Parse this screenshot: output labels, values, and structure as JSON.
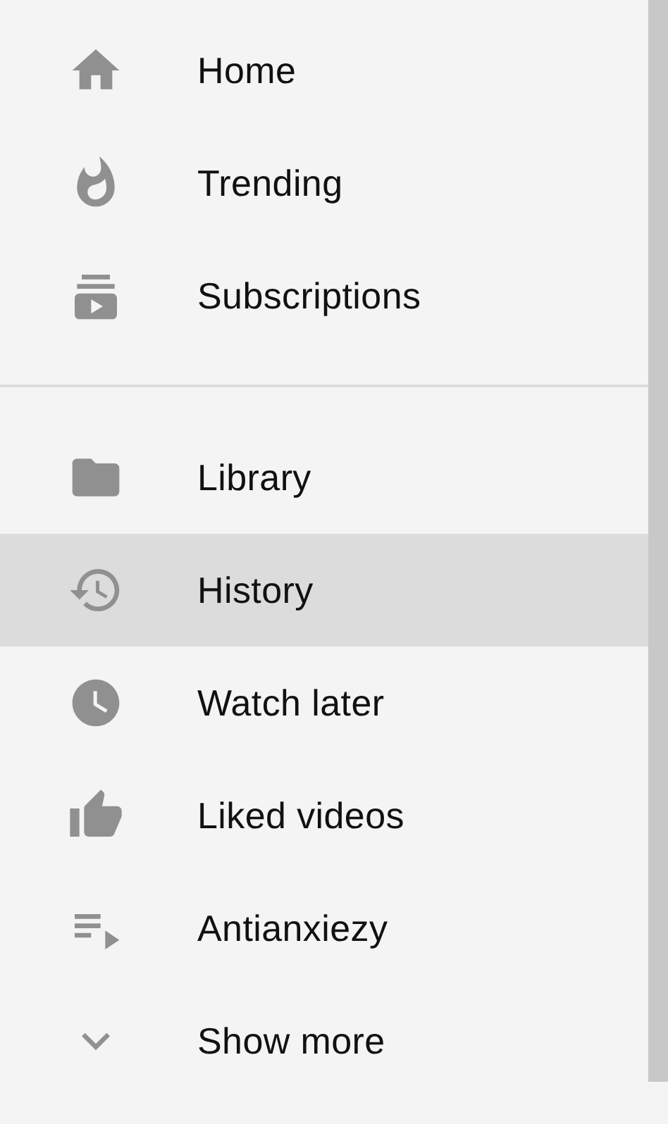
{
  "sections": [
    {
      "items": [
        {
          "label": "Home",
          "selected": false
        },
        {
          "label": "Trending",
          "selected": false
        },
        {
          "label": "Subscriptions",
          "selected": false
        }
      ]
    },
    {
      "items": [
        {
          "label": "Library",
          "selected": false
        },
        {
          "label": "History",
          "selected": true
        },
        {
          "label": "Watch later",
          "selected": false
        },
        {
          "label": "Liked videos",
          "selected": false
        },
        {
          "label": "Antianxiezy",
          "selected": false
        },
        {
          "label": "Show more",
          "selected": false
        }
      ]
    }
  ]
}
